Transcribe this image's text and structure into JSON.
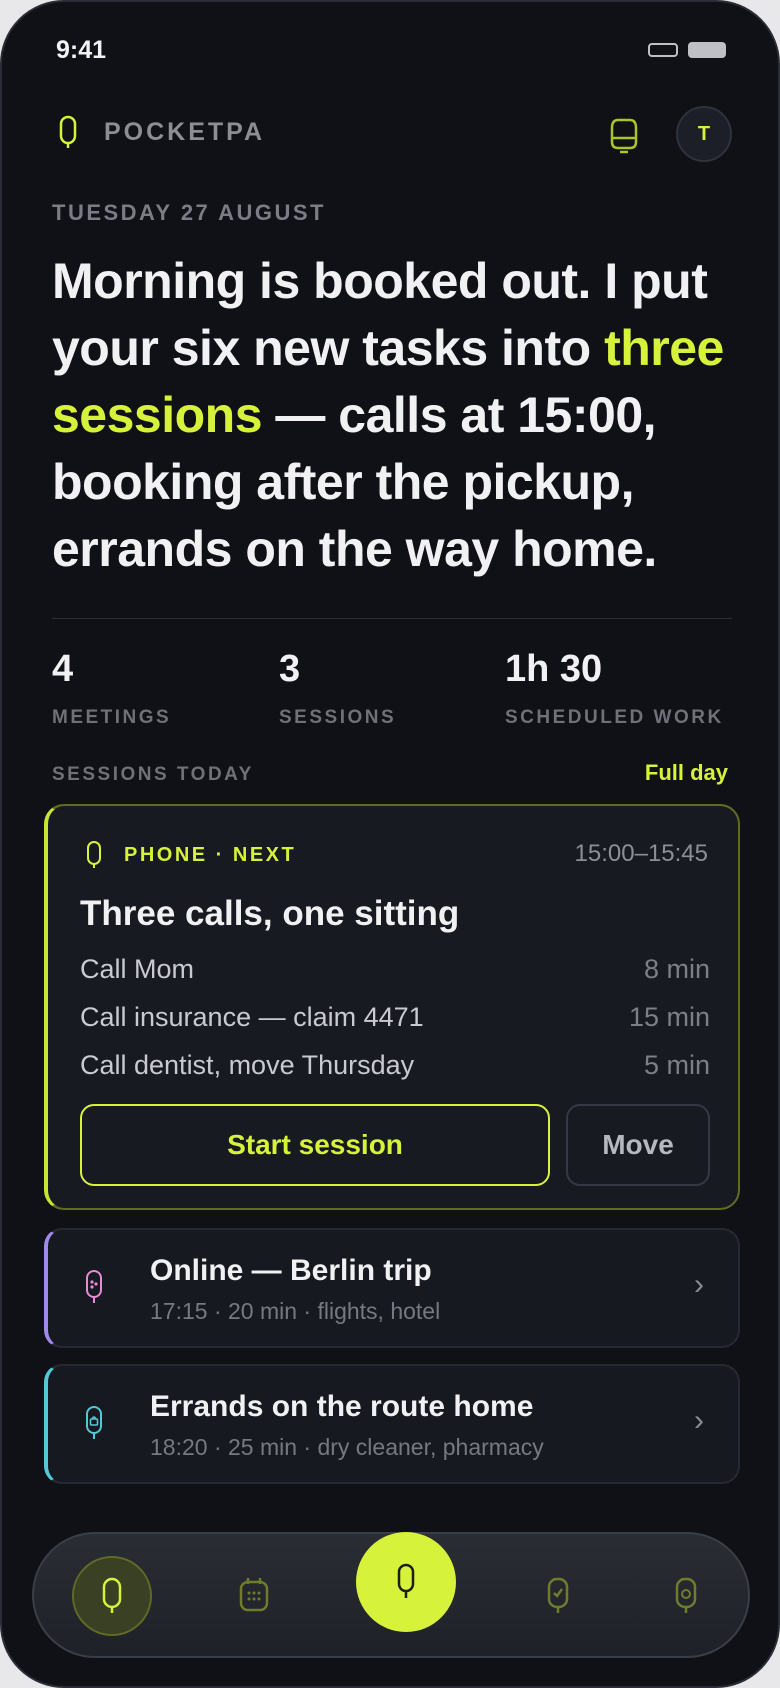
{
  "status_bar": {
    "time": "9:41"
  },
  "header": {
    "brand": "POCKETPA",
    "avatar_initial": "T"
  },
  "date": "TUESDAY 27 AUGUST",
  "headline": {
    "part1": "Morning is booked out. I put your six new tasks into ",
    "highlight": "three sessions",
    "part2": " — calls at 15:00, booking after the pickup, errands on the way home."
  },
  "stats": [
    {
      "value": "4",
      "label": "MEETINGS"
    },
    {
      "value": "3",
      "label": "SESSIONS"
    },
    {
      "value": "1h 30",
      "label": "SCHEDULED WORK"
    }
  ],
  "sessions_header": {
    "title": "SESSIONS TODAY",
    "link": "Full day"
  },
  "next_session": {
    "tag": "PHONE · NEXT",
    "time": "15:00–15:45",
    "title": "Three calls, one sitting",
    "tasks": [
      {
        "name": "Call Mom",
        "duration": "8 min"
      },
      {
        "name": "Call insurance — claim 4471",
        "duration": "15 min"
      },
      {
        "name": "Call dentist, move Thursday",
        "duration": "5 min"
      }
    ],
    "start_label": "Start session",
    "move_label": "Move"
  },
  "other_sessions": [
    {
      "title": "Online — Berlin trip",
      "subtitle": "17:15 · 20 min · flights, hotel",
      "accent": "#a08bea"
    },
    {
      "title": "Errands on the route home",
      "subtitle": "18:20 · 25 min · dry cleaner, pharmacy",
      "accent": "#51c9d9"
    }
  ],
  "colors": {
    "accent": "#d6f23a",
    "background": "#0f1116",
    "card": "#171a21"
  },
  "nav_icons": [
    "home-icon",
    "calendar-icon",
    "capture-icon",
    "check-icon",
    "settings-icon"
  ]
}
